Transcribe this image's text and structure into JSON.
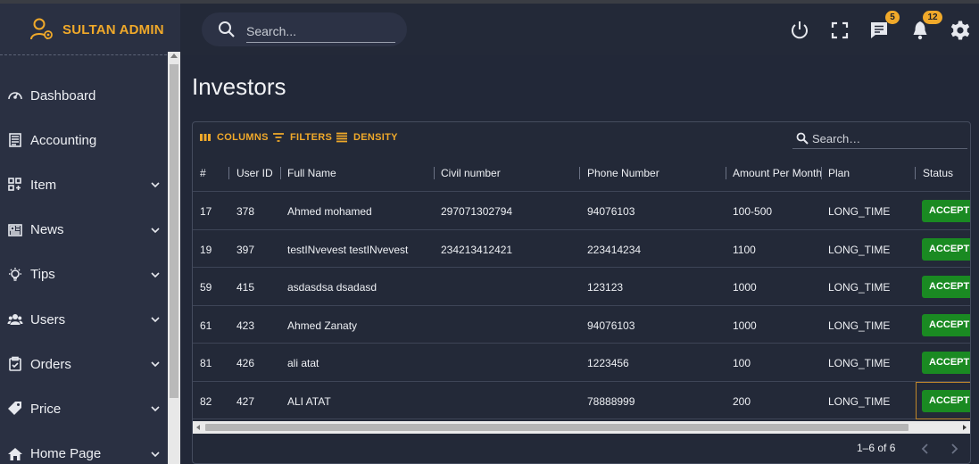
{
  "brand": {
    "name": "SULTAN ADMIN",
    "accent": "#f0a92a"
  },
  "header": {
    "search_placeholder": "Search...",
    "icons": [
      "power-icon",
      "fullscreen-icon",
      "chat-icon",
      "bell-icon",
      "gear-icon"
    ],
    "chat_badge": "5",
    "notif_badge": "12"
  },
  "sidebar": {
    "items": [
      {
        "label": "Dashboard",
        "icon": "gauge-icon",
        "expandable": false
      },
      {
        "label": "Accounting",
        "icon": "ledger-icon",
        "expandable": false
      },
      {
        "label": "Item",
        "icon": "grid-icon",
        "expandable": true
      },
      {
        "label": "News",
        "icon": "newspaper-icon",
        "expandable": true
      },
      {
        "label": "Tips",
        "icon": "bulb-icon",
        "expandable": true
      },
      {
        "label": "Users",
        "icon": "users-icon",
        "expandable": true
      },
      {
        "label": "Orders",
        "icon": "clipboard-icon",
        "expandable": true
      },
      {
        "label": "Price",
        "icon": "tag-icon",
        "expandable": true
      },
      {
        "label": "Home Page",
        "icon": "home-icon",
        "expandable": true
      }
    ]
  },
  "page": {
    "title": "Investors"
  },
  "grid": {
    "toolbar": {
      "columns": "COLUMNS",
      "filters": "FILTERS",
      "density": "DENSITY",
      "search_placeholder": "Search…"
    },
    "columns": [
      "#",
      "User ID",
      "Full Name",
      "Civil number",
      "Phone Number",
      "Amount Per Month",
      "Plan",
      "Status"
    ],
    "rows": [
      {
        "num": "17",
        "user_id": "378",
        "full_name": "Ahmed mohamed",
        "civil": "297071302794",
        "phone": "94076103",
        "amount": "100-500",
        "plan": "LONG_TIME",
        "status": "ACCEPTED"
      },
      {
        "num": "19",
        "user_id": "397",
        "full_name": "testINvevest testINvevest",
        "civil": "234213412421",
        "phone": "223414234",
        "amount": "1100",
        "plan": "LONG_TIME",
        "status": "ACCEPTED"
      },
      {
        "num": "59",
        "user_id": "415",
        "full_name": "asdasdsa dsadasd",
        "civil": "",
        "phone": "123123",
        "amount": "1000",
        "plan": "LONG_TIME",
        "status": "ACCEPTED"
      },
      {
        "num": "61",
        "user_id": "423",
        "full_name": "Ahmed Zanaty",
        "civil": "",
        "phone": "94076103",
        "amount": "1000",
        "plan": "LONG_TIME",
        "status": "ACCEPTED"
      },
      {
        "num": "81",
        "user_id": "426",
        "full_name": "ali atat",
        "civil": "",
        "phone": "1223456",
        "amount": "100",
        "plan": "LONG_TIME",
        "status": "ACCEPTED"
      },
      {
        "num": "82",
        "user_id": "427",
        "full_name": "ALI ATAT",
        "civil": "",
        "phone": "78888999",
        "amount": "200",
        "plan": "LONG_TIME",
        "status": "ACCEPTED"
      }
    ],
    "pagination": "1–6 of 6"
  }
}
